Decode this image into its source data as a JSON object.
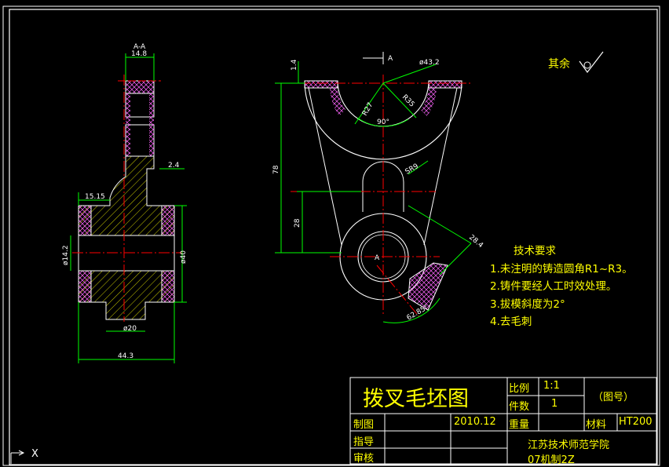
{
  "dimensions": {
    "section_label": "A-A",
    "width_top": "14.8",
    "offset": "2.4",
    "hub_step": "15.15",
    "bore_dia": "ø14.2",
    "hub_dia": "ø40",
    "boss_dia": "ø20",
    "overall_width": "44.3",
    "arc_outer": "ø43.2",
    "radius_inner": "R27",
    "radius_mid": "R35",
    "angle": "90°",
    "top_thickness": "1.4",
    "view_mark": "A",
    "height_total": "78",
    "height_lower": "28",
    "sphere_radius": "SR9",
    "length_arm": "28.4",
    "arc_angle": "62.85°",
    "center_label": "A"
  },
  "roughness": {
    "label": "其余"
  },
  "technical_requirements": {
    "title": "技术要求",
    "items": [
      "1.未注明的铸造圆角R1~R3。",
      "2.铸件要经人工时效处理。",
      "3.拔模斜度为2°",
      "4.去毛刺"
    ]
  },
  "title_block": {
    "drawing_title": "拨叉毛坯图",
    "scale_label": "比例",
    "scale_value": "1:1",
    "quantity_label": "件数",
    "quantity_value": "1",
    "drawing_number": "（图号）",
    "weight_label": "重量",
    "material_label": "材料",
    "material_value": "HT200",
    "drafter_label": "制图",
    "date": "2010.12",
    "advisor_label": "指导",
    "reviewer_label": "审核",
    "school": "江苏技术师范学院",
    "class": "07机制2Z"
  },
  "ucs": {
    "x_label": "X"
  },
  "colors": {
    "outline": "#ffffff",
    "dimension": "#00ff00",
    "centerline": "#ff0000",
    "hatch": "#ffff00",
    "fillet": "#ff00ff",
    "text": "#ffff00"
  }
}
